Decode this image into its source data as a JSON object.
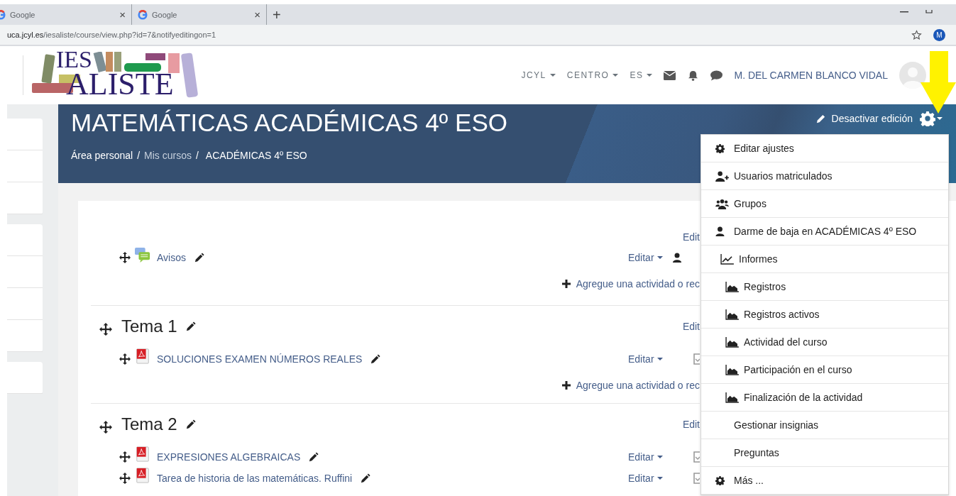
{
  "browser": {
    "tabs": [
      {
        "label": "Google",
        "close": "×"
      },
      {
        "label": "Google",
        "close": "×"
      }
    ],
    "new_tab": "+",
    "url_host": "uca.jcyl.es",
    "url_path": "/iesaliste/course/view.php?id=7&notifyeditingon=1",
    "profile": "M"
  },
  "header": {
    "logo_top": "IES",
    "logo_bottom": "ALISTE",
    "nav": [
      "JCYL",
      "CENTRO",
      "ES"
    ],
    "user": "M. DEL CARMEN BLANCO VIDAL"
  },
  "banner": {
    "title": "MATEMÁTICAS ACADÉMICAS 4º ESO",
    "breadcrumb": [
      {
        "label": "Área personal",
        "kind": "home"
      },
      {
        "label": "Mis cursos",
        "kind": "link"
      },
      {
        "label": "ACADÉMICAS 4º ESO",
        "kind": "current"
      }
    ],
    "separator": "/",
    "edit_button": "Desactivar edición"
  },
  "sections": [
    {
      "edit": "Edit",
      "items": [
        {
          "kind": "forum",
          "name": "Avisos",
          "edit": "Editar",
          "status": {
            "kind": "user"
          }
        }
      ],
      "add": "Agregue una actividad o rec"
    },
    {
      "title": "Tema 1",
      "edit": "Edit",
      "items": [
        {
          "kind": "pdf",
          "name": "SOLUCIONES EXAMEN NÚMEROS REALES",
          "edit": "Editar",
          "status": {
            "kind": "checkbox"
          }
        }
      ],
      "add": "Agregue una actividad o rec"
    },
    {
      "title": "Tema 2",
      "edit": "Edit",
      "items": [
        {
          "kind": "pdf",
          "name": "EXPRESIONES ALGEBRAICAS",
          "edit": "Editar",
          "status": {
            "kind": "checkbox"
          }
        },
        {
          "kind": "pdf",
          "name": "Tarea de historia de las matemáticas. Ruffini",
          "edit": "Editar",
          "status": {
            "kind": "checkbox"
          }
        }
      ]
    }
  ],
  "menu": [
    {
      "label": "Editar ajustes",
      "kind": "gear"
    },
    {
      "label": "Usuarios matriculados",
      "kind": "user-plus"
    },
    {
      "label": "Grupos",
      "kind": "users"
    },
    {
      "label": "Darme de baja en ACADÉMICAS 4º ESO",
      "kind": "user"
    },
    {
      "label": "Informes",
      "kind": "chart"
    },
    {
      "label": "Registros",
      "kind": "area"
    },
    {
      "label": "Registros activos",
      "kind": "area"
    },
    {
      "label": "Actividad del curso",
      "kind": "area"
    },
    {
      "label": "Participación en el curso",
      "kind": "area"
    },
    {
      "label": "Finalización de la actividad",
      "kind": "area"
    },
    {
      "label": "Gestionar insignias",
      "kind": "none"
    },
    {
      "label": "Preguntas",
      "kind": "none"
    },
    {
      "label": "Más ...",
      "kind": "gear"
    }
  ]
}
